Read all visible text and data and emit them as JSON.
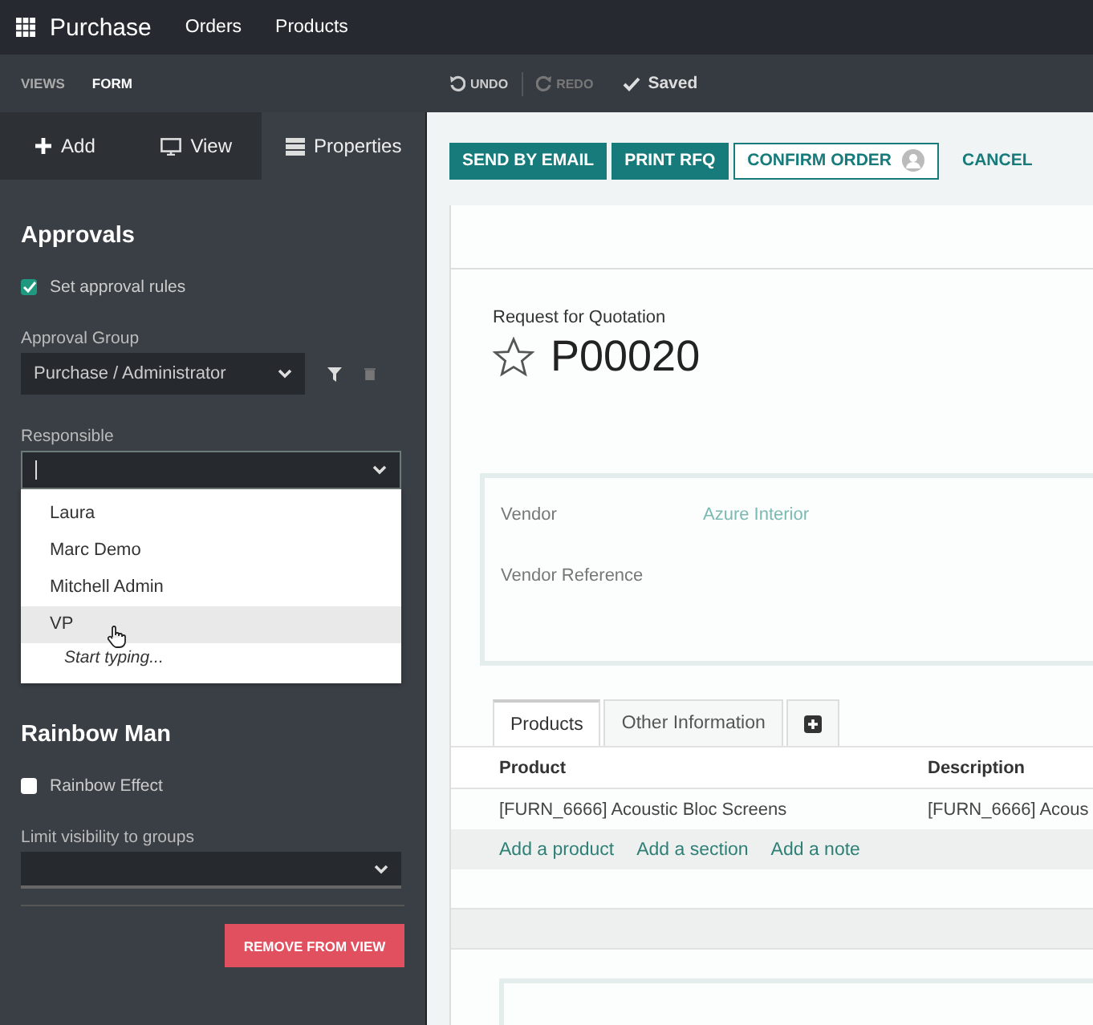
{
  "navbar": {
    "app": "Purchase",
    "menu": [
      "Orders",
      "Products"
    ]
  },
  "editor_bar": {
    "tabs": [
      {
        "label": "VIEWS",
        "selected": false
      },
      {
        "label": "FORM",
        "selected": true
      }
    ],
    "undo": {
      "label": "UNDO",
      "disabled": false
    },
    "redo": {
      "label": "REDO",
      "disabled": true
    },
    "status": "Saved"
  },
  "sidebar": {
    "tabs": [
      {
        "label": "Add",
        "kind": "add",
        "selected": false
      },
      {
        "label": "View",
        "kind": "view",
        "selected": false
      },
      {
        "label": "Properties",
        "kind": "properties",
        "selected": true
      }
    ],
    "approvals": {
      "title": "Approvals",
      "rules": {
        "label": "Set approval rules",
        "checked": true
      },
      "group_label": "Approval Group",
      "group_value": "Purchase / Administrator",
      "responsible_label": "Responsible",
      "options": [
        {
          "label": "Laura",
          "selected": false
        },
        {
          "label": "Marc Demo",
          "selected": false
        },
        {
          "label": "Mitchell Admin",
          "selected": false
        },
        {
          "label": "VP",
          "selected": true
        }
      ],
      "hint": "Start typing..."
    },
    "rainbow": {
      "title": "Rainbow Man",
      "effect": {
        "label": "Rainbow Effect",
        "checked": false
      },
      "visibility_label": "Limit visibility to groups"
    },
    "remove_button": "REMOVE FROM VIEW"
  },
  "actions": [
    {
      "label": "SEND BY EMAIL",
      "kind": "primary"
    },
    {
      "label": "PRINT RFQ",
      "kind": "primary"
    },
    {
      "label": "CONFIRM ORDER",
      "kind": "secondary"
    },
    {
      "label": "CANCEL",
      "kind": "link"
    }
  ],
  "form": {
    "subtitle": "Request for Quotation",
    "title": "P00020",
    "starred": false,
    "fields": [
      {
        "label": "Vendor",
        "value": "Azure Interior"
      },
      {
        "label": "Vendor Reference"
      }
    ],
    "tabs": [
      {
        "label": "Products",
        "selected": true
      },
      {
        "label": "Other Information",
        "selected": false
      }
    ],
    "table": {
      "columns": [
        "Product",
        "Description"
      ],
      "rows": [
        [
          "[FURN_6666] Acoustic Bloc Screens",
          "[FURN_6666] Acous"
        ]
      ],
      "add_links": [
        "Add a product",
        "Add a section",
        "Add a note"
      ]
    }
  }
}
